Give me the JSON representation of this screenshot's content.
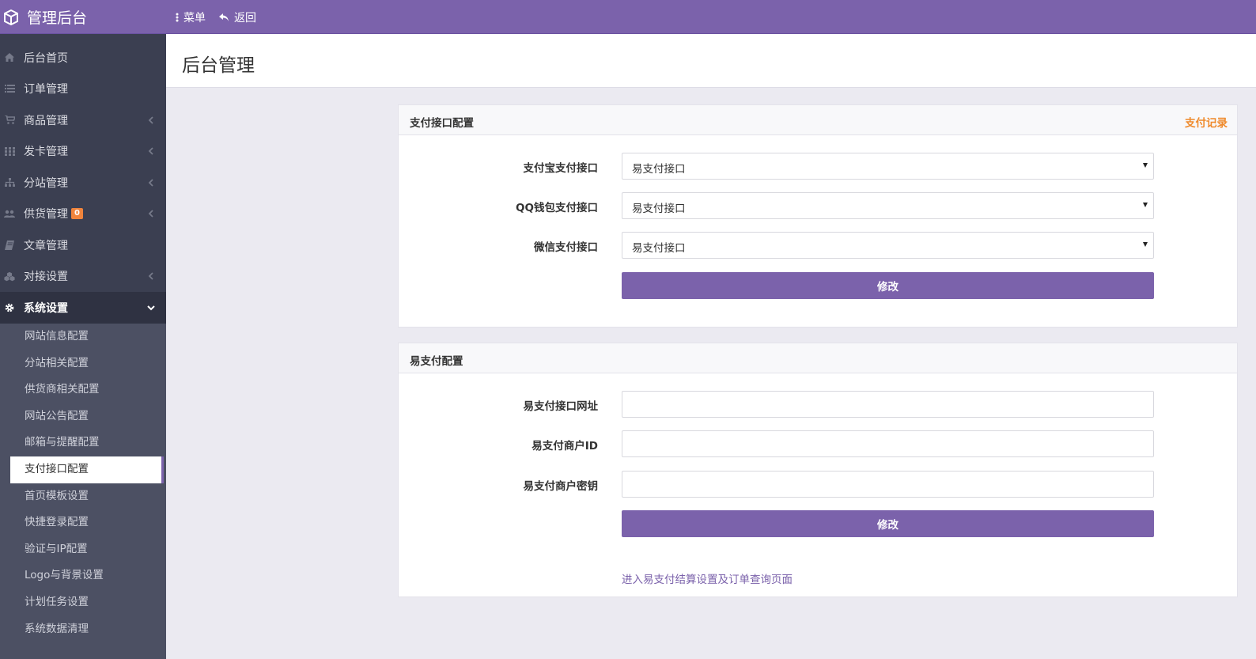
{
  "topbar": {
    "brand": "管理后台",
    "brand_icon": "cube-icon",
    "menu_label": "菜单",
    "back_label": "返回",
    "bg": "#7b62ab"
  },
  "sidebar": {
    "items": [
      {
        "label": "后台首页",
        "icon": "home-icon"
      },
      {
        "label": "订单管理",
        "icon": "list-icon"
      },
      {
        "label": "商品管理",
        "icon": "cart-icon"
      },
      {
        "label": "发卡管理",
        "icon": "grid-icon"
      },
      {
        "label": "分站管理",
        "icon": "sitemap-icon"
      },
      {
        "label": "供货管理",
        "icon": "users-icon",
        "badge": "0"
      },
      {
        "label": "文章管理",
        "icon": "book-icon"
      },
      {
        "label": "对接设置",
        "icon": "cubes-icon"
      },
      {
        "label": "系统设置",
        "icon": "gear-icon"
      }
    ],
    "submenu": [
      "网站信息配置",
      "分站相关配置",
      "供货商相关配置",
      "网站公告配置",
      "邮箱与提醒配置",
      "支付接口配置",
      "首页模板设置",
      "快捷登录配置",
      "验证与IP配置",
      "Logo与背景设置",
      "计划任务设置",
      "系统数据清理"
    ],
    "selected_submenu": "支付接口配置"
  },
  "page": {
    "title": "后台管理"
  },
  "payment_panel": {
    "title": "支付接口配置",
    "link": "支付记录",
    "fields": [
      {
        "label": "支付宝支付接口",
        "value": "易支付接口"
      },
      {
        "label": "QQ钱包支付接口",
        "value": "易支付接口"
      },
      {
        "label": "微信支付接口",
        "value": "易支付接口"
      }
    ],
    "submit": "修改"
  },
  "epay_panel": {
    "title": "易支付配置",
    "fields": [
      {
        "label": "易支付接口网址",
        "value": ""
      },
      {
        "label": "易支付商户ID",
        "value": ""
      },
      {
        "label": "易支付商户密钥",
        "value": ""
      }
    ],
    "submit": "修改",
    "footer_link": "进入易支付结算设置及订单查询页面"
  },
  "colors": {
    "accent": "#7b62ab",
    "orange": "#ef8a2c",
    "sidebar": "#3b3f51",
    "submenu": "#4c5063"
  }
}
